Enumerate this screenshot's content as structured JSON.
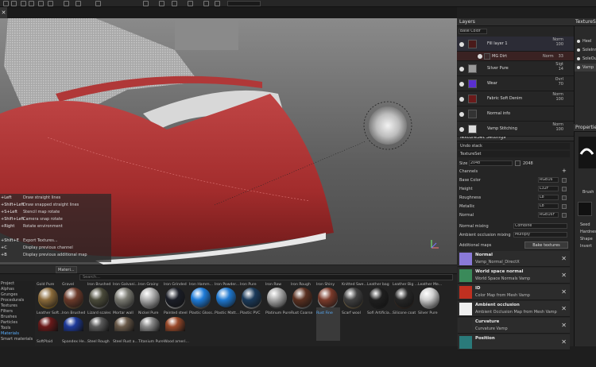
{
  "viewport_shortcuts": [
    {
      "key": "+Left",
      "desc": "Draw straight lines"
    },
    {
      "key": "+Shift+Left",
      "desc": "Draw snapped straight lines"
    },
    {
      "key": "+S+Left",
      "desc": "Stencil map rotate"
    },
    {
      "key": "+Shift+Left",
      "desc": "Camera snap rotate"
    },
    {
      "key": "+Right",
      "desc": "Rotate environment"
    },
    {
      "key": "",
      "desc": ""
    },
    {
      "key": "+Shift+E",
      "desc": "Export Textures..."
    },
    {
      "key": "+C",
      "desc": "Display previous channel"
    },
    {
      "key": "+B",
      "desc": "Display previous additional map"
    }
  ],
  "shelf": {
    "tabs": [
      "Materi...",
      "Search..."
    ],
    "categories": [
      "Project",
      "Alphas",
      "Grunges",
      "Procedurals",
      "Textures",
      "Filters",
      "Brushes",
      "Particles",
      "Tools",
      "Materials",
      "Smart materials"
    ],
    "row1": [
      {
        "name": "Gold Pure",
        "color": "#b88a2f"
      },
      {
        "name": "Gravel",
        "color": "#7a5a3a"
      },
      {
        "name": "Iron Brushed",
        "color": "#8a8a8a"
      },
      {
        "name": "Iron Galvani...",
        "color": "#7d7d7d"
      },
      {
        "name": "Iron Grainy",
        "color": "#9a9a9a"
      },
      {
        "name": "Iron Grinded",
        "color": "#b5b5b5"
      },
      {
        "name": "Iron Hamm...",
        "color": "#6f6f6f"
      },
      {
        "name": "Iron Powder...",
        "color": "#2d2d2d"
      },
      {
        "name": "Iron Pure",
        "color": "#a5a5a5"
      },
      {
        "name": "Iron Raw",
        "color": "#555555"
      },
      {
        "name": "Iron Rough",
        "color": "#8d8d8d"
      },
      {
        "name": "Iron Shiny",
        "color": "#c8c8c8"
      },
      {
        "name": "Knitted Swe...",
        "color": "#7b6a4d"
      },
      {
        "name": "Leather bag",
        "color": "#222222"
      },
      {
        "name": "Leather Big ...",
        "color": "#3a2d25"
      },
      {
        "name": "Leather Me...",
        "color": "#b5b5b5"
      }
    ],
    "row2": [
      {
        "name": "Leather Soft...",
        "color": "#8a6a3a"
      },
      {
        "name": "Iron Brushed",
        "color": "#6b3a2a"
      },
      {
        "name": "Lizard scales",
        "color": "#4a4a3a"
      },
      {
        "name": "Mortar wall",
        "color": "#7a7a72"
      },
      {
        "name": "Nickel Pure",
        "color": "#b0b0b0"
      },
      {
        "name": "Painted steel",
        "color": "#1a1d26"
      },
      {
        "name": "Plastic Gloss...",
        "color": "#1e7bd8"
      },
      {
        "name": "Plastic Matt...",
        "color": "#1e78d0"
      },
      {
        "name": "Plastic PVC",
        "color": "#1a3a5a"
      },
      {
        "name": "Platinum Pure",
        "color": "#a8a8a8"
      },
      {
        "name": "Rust Coarse",
        "color": "#5a3020"
      },
      {
        "name": "Rust Fine",
        "color": "#7a3a2a"
      },
      {
        "name": "Scarf wool",
        "color": "#404040"
      },
      {
        "name": "Sofi Artificia...",
        "color": "#1f1f1f"
      },
      {
        "name": "Silicone coat",
        "color": "#262626"
      },
      {
        "name": "Silver Pure",
        "color": "#cfcfcf"
      }
    ],
    "row3": [
      {
        "name": "SoftPlaid",
        "color": "#6a1a1a"
      },
      {
        "name": "Spandex He...",
        "color": "#1e3a9a"
      },
      {
        "name": "Steel Rough",
        "color": "#5a5a5a"
      },
      {
        "name": "Steel Rust a...",
        "color": "#6a5a4a"
      },
      {
        "name": "Titanium Pure",
        "color": "#8a8a8a"
      },
      {
        "name": "Wood ameri...",
        "color": "#9a4a2a"
      }
    ],
    "selected_index": 11
  },
  "layers": {
    "title": "Layers",
    "channel": "Base Color",
    "rows": [
      {
        "name": "Fill layer 1",
        "blend": "Norm",
        "opacity": "100",
        "thumb": "#4a1a1a",
        "selected": true
      },
      {
        "name": "MG Dirt",
        "blend": "Norm",
        "opacity": "33",
        "thumb": "#3a2a2a",
        "sub": true
      },
      {
        "name": "Silver Pure",
        "blend": "Sigt",
        "opacity": "14",
        "thumb": "#9a9a9a"
      },
      {
        "name": "Wear",
        "blend": "Ovrl",
        "opacity": "70",
        "thumb": "#5a2fd0"
      },
      {
        "name": "Fabric Soft Denim",
        "blend": "Norm",
        "opacity": "100",
        "thumb": "#6a1a1a"
      },
      {
        "name": "Normal info",
        "blend": "",
        "opacity": "",
        "thumb": "#333333"
      },
      {
        "name": "Vamp Stitching",
        "blend": "Norm",
        "opacity": "100",
        "thumb": "#dddddd"
      }
    ]
  },
  "textureset_settings": {
    "title": "TextureSet Settings",
    "undo_stack": "Undo stack",
    "textureset_tab": "TextureSet",
    "size_label": "Size",
    "size_value": "2048",
    "size_value2": "2048",
    "channels_label": "Channels",
    "channels": [
      {
        "name": "Base Color",
        "format": "RGB16"
      },
      {
        "name": "Height",
        "format": "L32F"
      },
      {
        "name": "Roughness",
        "format": "L8"
      },
      {
        "name": "Metallic",
        "format": "L8"
      },
      {
        "name": "Normal",
        "format": "RGB16F"
      }
    ],
    "normal_mixing_label": "Normal mixing",
    "normal_mixing_value": "Combine",
    "ao_mixing_label": "Ambient occlusion mixing",
    "ao_mixing_value": "Multiply",
    "additional_maps_label": "Additional maps",
    "bake_button": "Bake textures",
    "maps": [
      {
        "title": "Normal",
        "sub": "Vamp_Normal_DirectX",
        "thumb": "#8a7ad8"
      },
      {
        "title": "World space normal",
        "sub": "World Space Normals Vamp",
        "thumb": "#3a8a5a"
      },
      {
        "title": "ID",
        "sub": "Color Map from Mesh Vamp",
        "thumb": "#c03020"
      },
      {
        "title": "Ambient occlusion",
        "sub": "Ambient Occlusion Map from Mesh Vamp",
        "thumb": "#f0f0f0"
      },
      {
        "title": "Curvature",
        "sub": "Curvature Vamp",
        "thumb": "#2a2a2a"
      },
      {
        "title": "Position",
        "sub": "",
        "thumb": "#2a7a7a"
      }
    ]
  },
  "textureset_list": {
    "title": "TextureSet",
    "items": [
      "Heel",
      "SoleInn",
      "SoleOu",
      "Vamp"
    ]
  },
  "properties": {
    "title": "Properties",
    "brush_label": "Brush",
    "items": [
      "Seed",
      "Hardnes",
      "Shape",
      "Invert"
    ]
  }
}
